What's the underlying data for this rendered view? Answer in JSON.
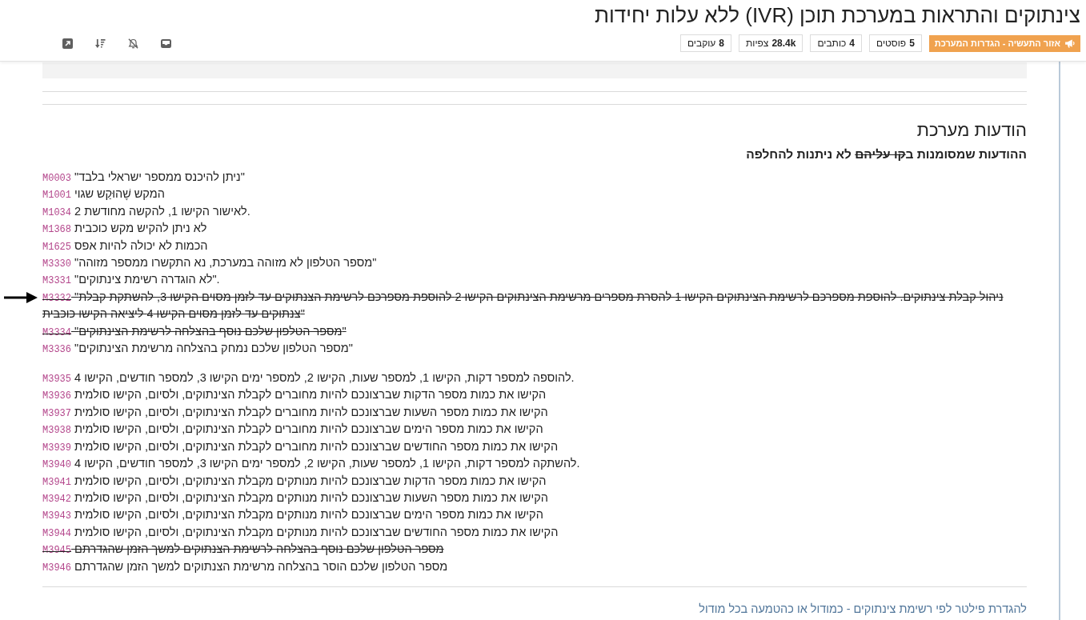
{
  "topic": {
    "title": "צינתוקים והתראות במערכת תוכן (IVR) ללא עלות יחידות",
    "category": "אזור התעשיה - הגדרות המערכת",
    "stats": [
      {
        "count": "5",
        "label": "פוסטים"
      },
      {
        "count": "4",
        "label": "כותבים"
      },
      {
        "count": "28.4k",
        "label": "צפיות"
      },
      {
        "count": "8",
        "label": "עוקבים"
      }
    ]
  },
  "post": {
    "heading": "הודעות מערכת",
    "note": [
      {
        "text": "ההודעות שמסומנות ב",
        "strikethrough": false
      },
      {
        "text": "קו עליהם",
        "strikethrough": true
      },
      {
        "text": " לא ניתנות להחלפה",
        "strikethrough": false
      }
    ],
    "message_groups": [
      {
        "messages": [
          {
            "code": "M0003",
            "text": "\"ניתן להיכנס ממספר ישראלי בלבד\"",
            "strikethrough": false,
            "arrow": false
          },
          {
            "code": "M1001",
            "text": "המקש שֶׁהוּקַש שגוי",
            "strikethrough": false,
            "arrow": false
          },
          {
            "code": "M1034",
            "text": "לאישור הקישו 1, להקשה מחודשת 2.",
            "strikethrough": false,
            "arrow": false
          },
          {
            "code": "M1368",
            "text": "לא ניתן להקיש מקש כוכבית",
            "strikethrough": false,
            "arrow": false
          },
          {
            "code": "M1625",
            "text": "הכמות לא יכולה להיות אפס",
            "strikethrough": false,
            "arrow": false
          },
          {
            "code": "M3330",
            "text": "\"מספר הטלפון לא מזוהה במערכת, נא התקשרו ממספר מזוהה\"",
            "strikethrough": false,
            "arrow": false
          },
          {
            "code": "M3331",
            "text": "\"לא הוגדרה רשימת צינתוקים\".",
            "strikethrough": false,
            "arrow": false
          },
          {
            "code": "M3332",
            "text": "\"ניהול קבלת צינתוקים. להוספת מספרכם לרשימת הצינתוקים הקישו 1 להסרת מספרים מרשימת הצינתוקים הקישו 2 להוספת מספרכם לרשימת הצנתוקים עד לזמן מסוים הקישו 3, להשתקת קבלת צנתוקים עד לזמן מסוים הקישו 4 ליציאה הקישו כוכבית\"",
            "strikethrough": true,
            "arrow": true
          },
          {
            "code": "M3334",
            "text": "\"מספר הטלפון שלכם נוסף בהצלחה לרשימת הצינתוקים\"",
            "strikethrough": true,
            "arrow": false
          },
          {
            "code": "M3336",
            "text": "\"מספר הטלפון שלכם נמחק בהצלחה מרשימת הצינתוקים\"",
            "strikethrough": false,
            "arrow": false
          }
        ]
      },
      {
        "messages": [
          {
            "code": "M3935",
            "text": "להוספה למספר דקות, הקישו 1, למספר שעות, הקישו 2, למספר ימים הקישו 3, למספר חודשים, הקישו 4.",
            "strikethrough": false,
            "arrow": false
          },
          {
            "code": "M3936",
            "text": "הקישו את כמות מספר הדקות שברצונכם להיות מחוברים לקבלת הצינתוקים, ולסיום, הקישו סולמית",
            "strikethrough": false,
            "arrow": false
          },
          {
            "code": "M3937",
            "text": "הקישו את כמות מספר השעות שברצונכם להיות מחוברים לקבלת הצינתוקים, ולסיום, הקישו סולמית",
            "strikethrough": false,
            "arrow": false
          },
          {
            "code": "M3938",
            "text": "הקישו את כמות מספר הימים שברצונכם להיות מחוברים לקבלת הצינתוקים, ולסיום, הקישו סולמית",
            "strikethrough": false,
            "arrow": false
          },
          {
            "code": "M3939",
            "text": "הקישו את כמות מספר החודשים שברצונכם להיות מחוברים לקבלת הצינתוקים, ולסיום, הקישו סולמית",
            "strikethrough": false,
            "arrow": false
          },
          {
            "code": "M3940",
            "text": "להשתקה למספר דקות, הקישו 1, למספר שעות, הקישו 2, למספר ימים הקישו 3, למספר חודשים, הקישו 4.",
            "strikethrough": false,
            "arrow": false
          },
          {
            "code": "M3941",
            "text": "הקישו את כמות מספר הדקות שברצונכם להיות מנותקים מקבלת הצינתוקים, ולסיום, הקישו סולמית",
            "strikethrough": false,
            "arrow": false
          },
          {
            "code": "M3942",
            "text": "הקישו את כמות מספר השעות שברצונכם להיות מנותקים מקבלת הצינתוקים, ולסיום, הקישו סולמית",
            "strikethrough": false,
            "arrow": false
          },
          {
            "code": "M3943",
            "text": "הקישו את כמות מספר הימים שברצונכם להיות מנותקים מקבלת הצינתוקים, ולסיום, הקישו סולמית",
            "strikethrough": false,
            "arrow": false
          },
          {
            "code": "M3944",
            "text": "הקישו את כמות מספר החודשים שברצונכם להיות מנותקים מקבלת הצינתוקים, ולסיום, הקישו סולמית",
            "strikethrough": false,
            "arrow": false
          },
          {
            "code": "M3945",
            "text": "מספר הטלפון שלכם נוסף בהצלחה לרשימת הצנתוקים למשך הזמן שהגדרתם",
            "strikethrough": true,
            "arrow": false
          },
          {
            "code": "M3946",
            "text": "מספר הטלפון שלכם הוסר בהצלחה מרשימת הצנתוקים למשך הזמן שהגדרתם",
            "strikethrough": false,
            "arrow": false
          }
        ]
      }
    ],
    "link": "להגדרת פילטר לפי רשימת צינתוקים - כמודול או כהטמעה בכל מודול"
  }
}
